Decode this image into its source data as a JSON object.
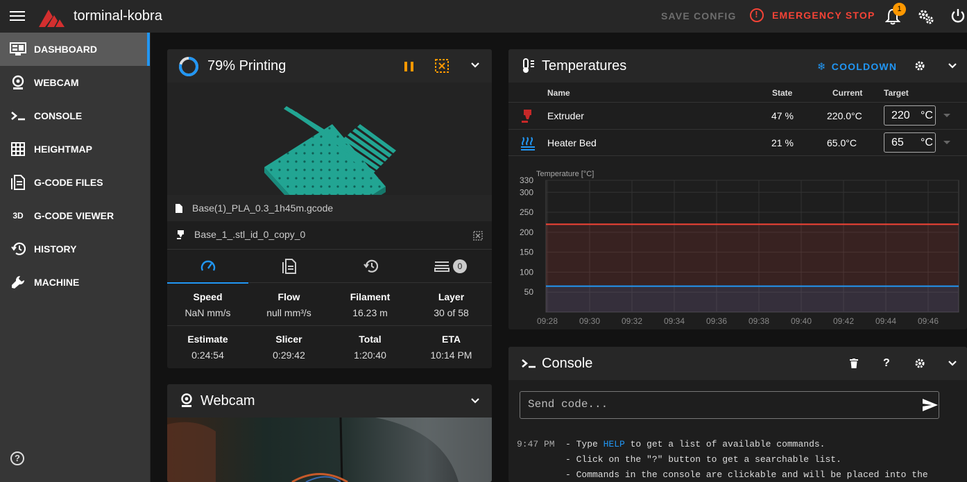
{
  "app": {
    "title": "torminal-kobra",
    "save_config": "SAVE CONFIG",
    "emergency_stop": "EMERGENCY STOP",
    "notification_count": "1",
    "accent": "#2196f3",
    "danger": "#f44336"
  },
  "sidebar": {
    "items": [
      {
        "label": "DASHBOARD",
        "icon": "monitor-dashboard-icon"
      },
      {
        "label": "WEBCAM",
        "icon": "webcam-icon"
      },
      {
        "label": "CONSOLE",
        "icon": "console-icon"
      },
      {
        "label": "HEIGHTMAP",
        "icon": "grid-icon"
      },
      {
        "label": "G-CODE FILES",
        "icon": "file-document-icon"
      },
      {
        "label": "G-CODE VIEWER",
        "icon": "3d-icon"
      },
      {
        "label": "HISTORY",
        "icon": "history-icon"
      },
      {
        "label": "MACHINE",
        "icon": "wrench-icon"
      }
    ]
  },
  "print": {
    "title": "79% Printing",
    "progress": 0.79,
    "gcode_file": "Base(1)_PLA_0.3_1h45m.gcode",
    "object": "Base_1_.stl_id_0_copy_0",
    "queue_count": "0",
    "stats": {
      "speed_label": "Speed",
      "speed": "NaN mm/s",
      "flow_label": "Flow",
      "flow": "null mm³/s",
      "filament_label": "Filament",
      "filament": "16.23 m",
      "layer_label": "Layer",
      "layer": "30 of 58",
      "estimate_label": "Estimate",
      "estimate": "0:24:54",
      "slicer_label": "Slicer",
      "slicer": "0:29:42",
      "total_label": "Total",
      "total": "1:20:40",
      "eta_label": "ETA",
      "eta": "10:14 PM"
    }
  },
  "webcam": {
    "title": "Webcam"
  },
  "temperatures": {
    "title": "Temperatures",
    "cooldown": "COOLDOWN",
    "headers": {
      "name": "Name",
      "state": "State",
      "current": "Current",
      "target": "Target"
    },
    "rows": [
      {
        "name": "Extruder",
        "state": "47 %",
        "current": "220.0°C",
        "target": "220",
        "unit": "°C",
        "color": "#f44336"
      },
      {
        "name": "Heater Bed",
        "state": "21 %",
        "current": "65.0°C",
        "target": "65",
        "unit": "°C",
        "color": "#2196f3"
      }
    ]
  },
  "chart_data": {
    "type": "line",
    "ylabel": "Temperature [°C]",
    "ylim": [
      0,
      330
    ],
    "yticks": [
      50,
      100,
      150,
      200,
      250,
      300,
      330
    ],
    "x": [
      "09:28",
      "09:30",
      "09:32",
      "09:34",
      "09:36",
      "09:38",
      "09:40",
      "09:42",
      "09:44",
      "09:46"
    ],
    "grid": true,
    "series": [
      {
        "values": [
          220,
          220,
          220,
          220,
          220,
          220,
          220,
          220,
          220,
          220
        ],
        "color": "#f44336"
      },
      {
        "values": [
          65,
          65,
          65,
          65,
          65,
          65,
          65,
          65,
          65,
          65
        ],
        "color": "#2196f3"
      }
    ]
  },
  "console": {
    "title": "Console",
    "placeholder": "Send code...",
    "time": "9:47 PM",
    "line1_pre": "- Type ",
    "line1_link": "HELP",
    "line1_post": " to get a list of available commands.",
    "line2": "- Click on the \"?\" button to get a searchable list.",
    "line3": "- Commands in the console are clickable and will be placed into the"
  }
}
